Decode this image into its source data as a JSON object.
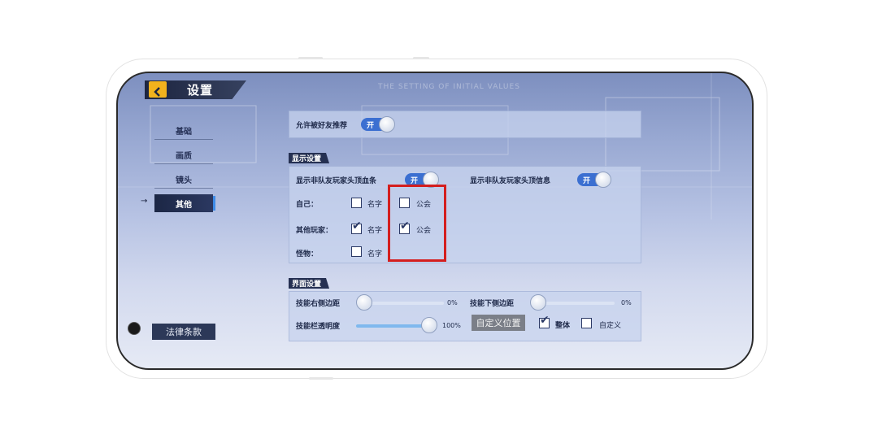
{
  "header": {
    "title": "设置",
    "watermark": "THE SETTING OF INITIAL VALUES"
  },
  "sidebar": {
    "items": [
      {
        "label": "基础",
        "active": false
      },
      {
        "label": "画质",
        "active": false
      },
      {
        "label": "镜头",
        "active": false
      },
      {
        "label": "其他",
        "active": true
      }
    ],
    "active_marker": "→",
    "legal_label": "法律条款"
  },
  "friends": {
    "label": "允许被好友推荐",
    "toggle": "开"
  },
  "display": {
    "section_title": "显示设置",
    "health_bar_label": "显示非队友玩家头顶血条",
    "health_bar_toggle": "开",
    "info_label": "显示非队友玩家头顶信息",
    "info_toggle": "开",
    "rows": [
      {
        "label": "自己：",
        "name_label": "名字",
        "name_checked": false,
        "guild_label": "公会",
        "guild_checked": false
      },
      {
        "label": "其他玩家：",
        "name_label": "名字",
        "name_checked": true,
        "guild_label": "公会",
        "guild_checked": true
      },
      {
        "label": "怪物：",
        "name_label": "名字",
        "name_checked": false
      }
    ]
  },
  "interface": {
    "section_title": "界面设置",
    "right_margin_label": "技能右侧边距",
    "right_margin_value": "0%",
    "bottom_margin_label": "技能下侧边距",
    "bottom_margin_value": "0%",
    "opacity_label": "技能栏透明度",
    "opacity_value": "100%",
    "opacity_fraction": 1.0,
    "custom_position_label": "自定义位置",
    "whole_label": "整体",
    "whole_checked": true,
    "custom_label": "自定义",
    "custom_checked": false
  },
  "colors": {
    "accent": "#3b6fd1",
    "highlight": "#d41e1e",
    "back_button": "#f2b21d"
  },
  "icons": {
    "back": "back-arrow-icon",
    "check": "check-icon"
  }
}
